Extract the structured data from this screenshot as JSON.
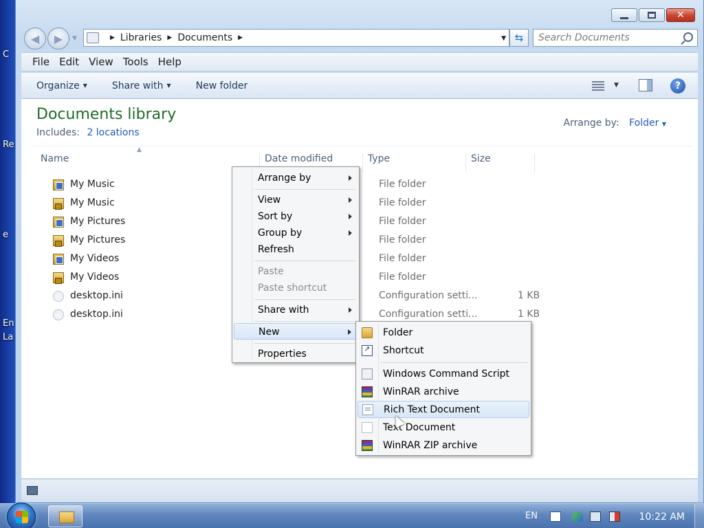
{
  "desktop": {
    "fragments": [
      "C",
      "Re",
      "e",
      "En",
      "La"
    ]
  },
  "window": {
    "caption": {
      "minimize": "minimize",
      "maximize": "maximize",
      "close": "✕"
    }
  },
  "address_bar": {
    "crumbs": [
      "Libraries",
      "Documents"
    ]
  },
  "search": {
    "placeholder": "Search Documents"
  },
  "menubar": {
    "file": "File",
    "edit": "Edit",
    "view": "View",
    "tools": "Tools",
    "help": "Help"
  },
  "command_bar": {
    "organize": "Organize",
    "share_with": "Share with",
    "new_folder": "New folder"
  },
  "library": {
    "title": "Documents library",
    "includes_label": "Includes:",
    "includes_link": "2 locations",
    "arrange_label": "Arrange by:",
    "arrange_value": "Folder"
  },
  "columns": {
    "name": "Name",
    "date": "Date modified",
    "type": "Type",
    "size": "Size"
  },
  "files": [
    {
      "name": "My Music",
      "type": "File folder",
      "size": ""
    },
    {
      "name": "My Music",
      "type": "File folder",
      "size": ""
    },
    {
      "name": "My Pictures",
      "type": "File folder",
      "size": ""
    },
    {
      "name": "My Pictures",
      "type": "File folder",
      "size": ""
    },
    {
      "name": "My Videos",
      "type": "File folder",
      "size": ""
    },
    {
      "name": "My Videos",
      "type": "File folder",
      "size": ""
    },
    {
      "name": "desktop.ini",
      "type": "Configuration setti...",
      "size": "1 KB"
    },
    {
      "name": "desktop.ini",
      "type": "Configuration setti...",
      "size": "1 KB"
    }
  ],
  "context_menu": {
    "arrange_by": "Arrange by",
    "view": "View",
    "sort_by": "Sort by",
    "group_by": "Group by",
    "refresh": "Refresh",
    "paste": "Paste",
    "paste_shortcut": "Paste shortcut",
    "share_with": "Share with",
    "new": "New",
    "properties": "Properties"
  },
  "new_submenu": {
    "folder": "Folder",
    "shortcut": "Shortcut",
    "cmd_script": "Windows Command Script",
    "winrar": "WinRAR archive",
    "rtf": "Rich Text Document",
    "txt": "Text Document",
    "winrar_zip": "WinRAR ZIP archive"
  },
  "taskbar": {
    "lang": "EN",
    "clock": "10:22 AM"
  }
}
